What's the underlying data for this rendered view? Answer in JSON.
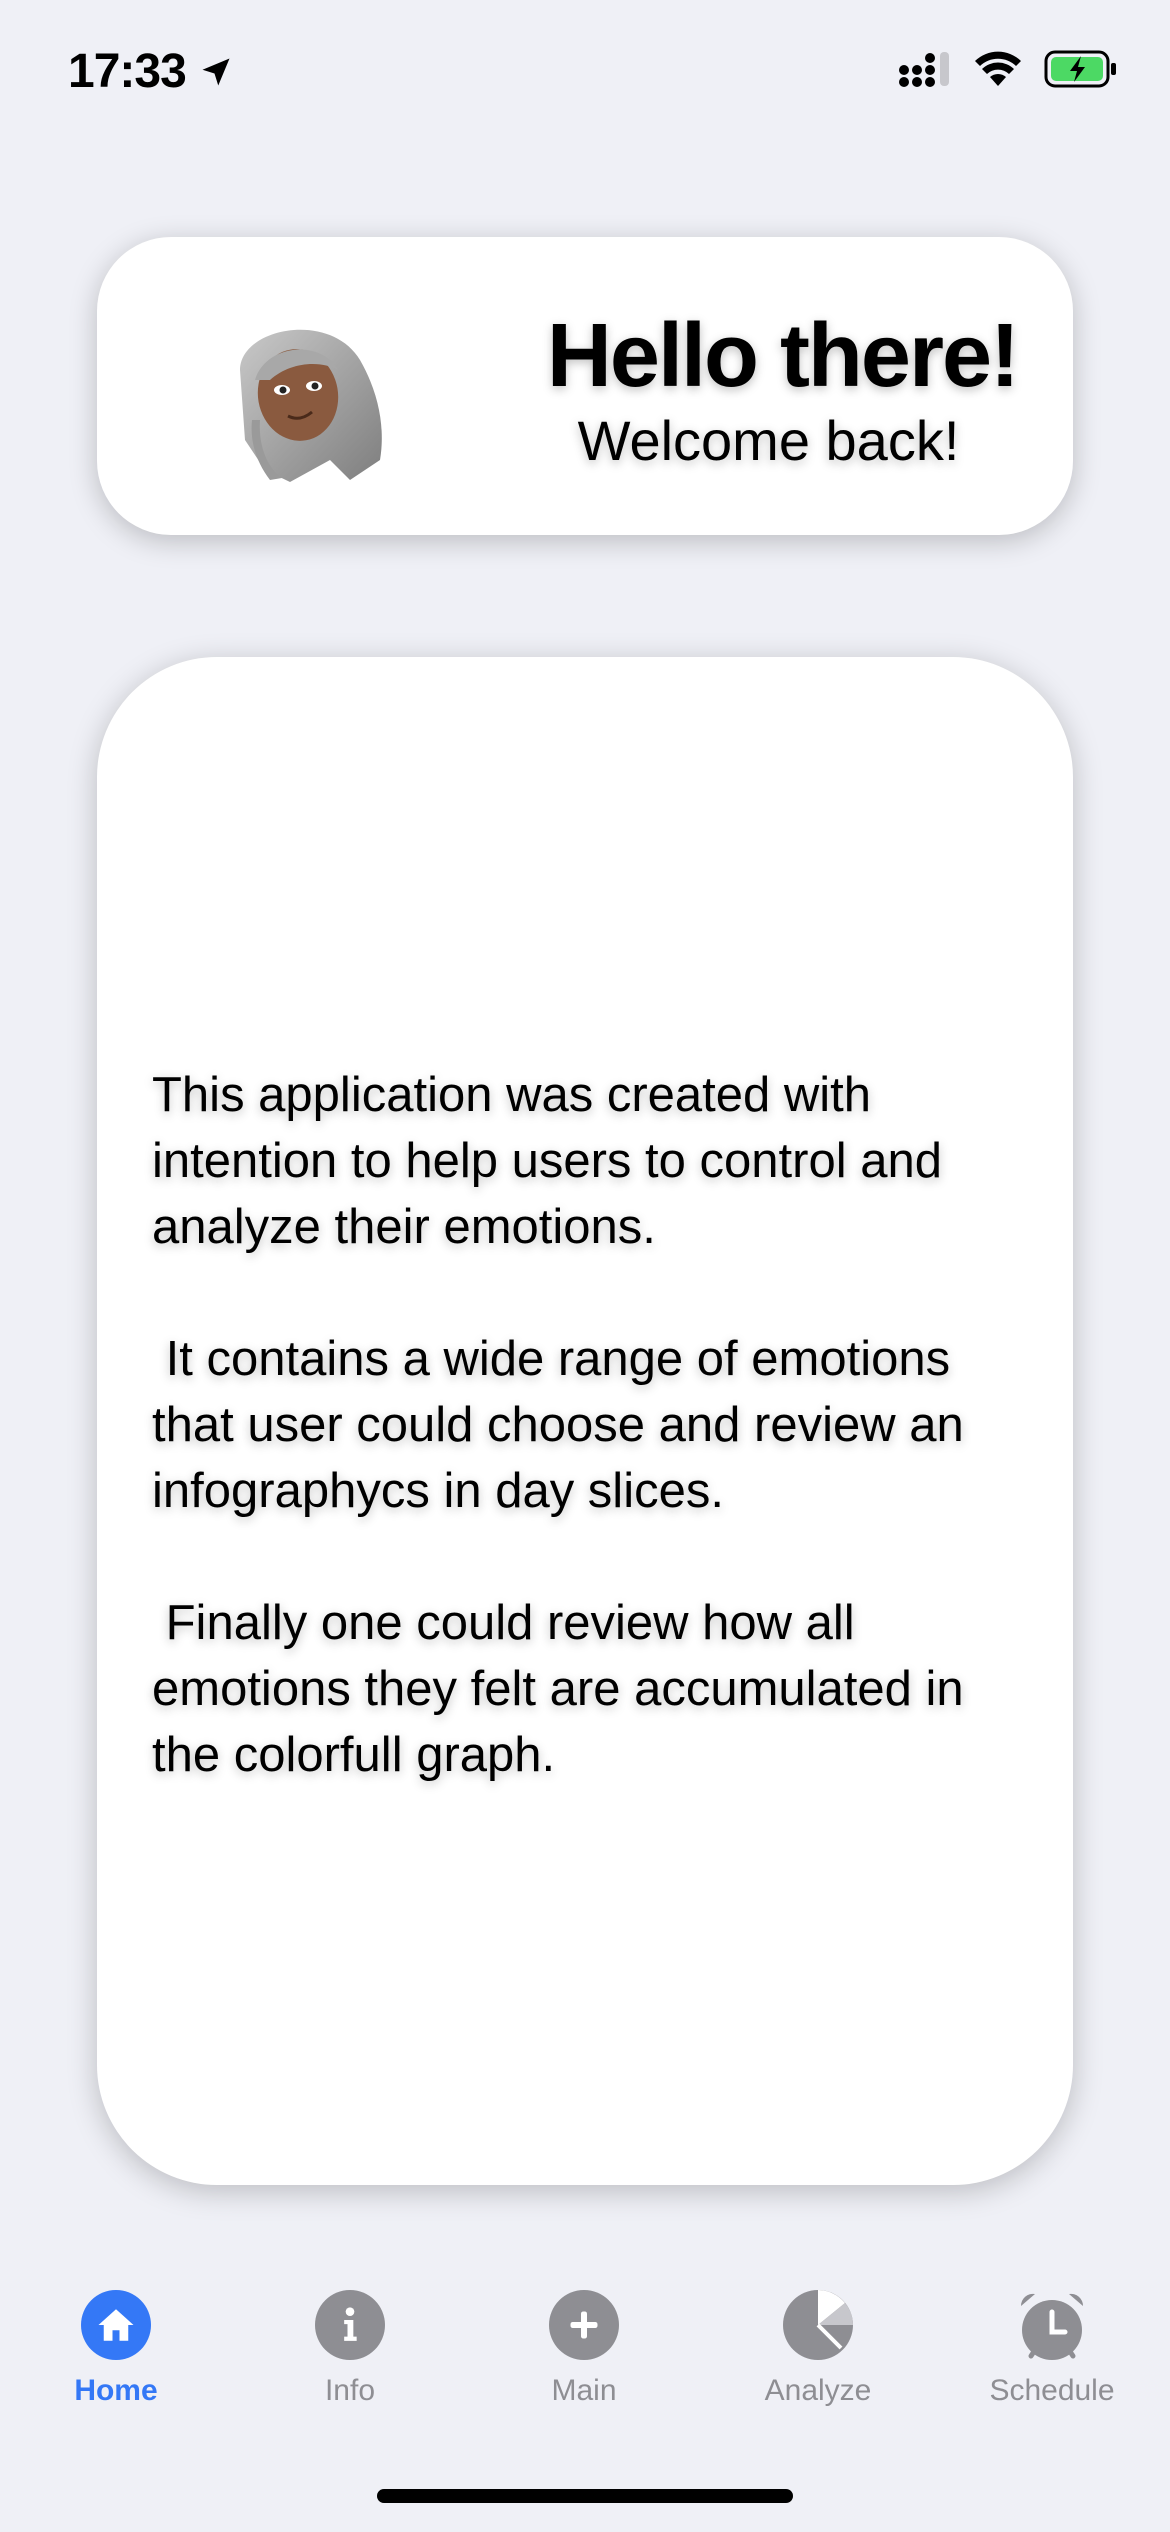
{
  "status_bar": {
    "time": "17:33",
    "icons": [
      "location-arrow-icon",
      "cellular-signal-icon",
      "wifi-icon",
      "battery-charging-icon"
    ],
    "battery_color": "#4cd964"
  },
  "greeting": {
    "title": "Hello there!",
    "subtitle": "Welcome back!",
    "avatar": "memoji-avatar"
  },
  "info": {
    "paragraphs": [
      "This application was created with intention to help users to control and analyze their emotions.",
      " It contains a wide range of emotions that user could choose and review an infographycs in day slices.",
      " Finally one could review how all emotions they felt are accumulated in the colorfull graph."
    ]
  },
  "tabs": [
    {
      "label": "Home",
      "icon": "house-icon",
      "active": true
    },
    {
      "label": "Info",
      "icon": "info-icon",
      "active": false
    },
    {
      "label": "Main",
      "icon": "plus-icon",
      "active": false
    },
    {
      "label": "Analyze",
      "icon": "pie-chart-icon",
      "active": false
    },
    {
      "label": "Schedule",
      "icon": "alarm-clock-icon",
      "active": false
    }
  ],
  "colors": {
    "accent": "#3478f6",
    "inactive": "#8e8e93",
    "background": "#eff0f6"
  }
}
